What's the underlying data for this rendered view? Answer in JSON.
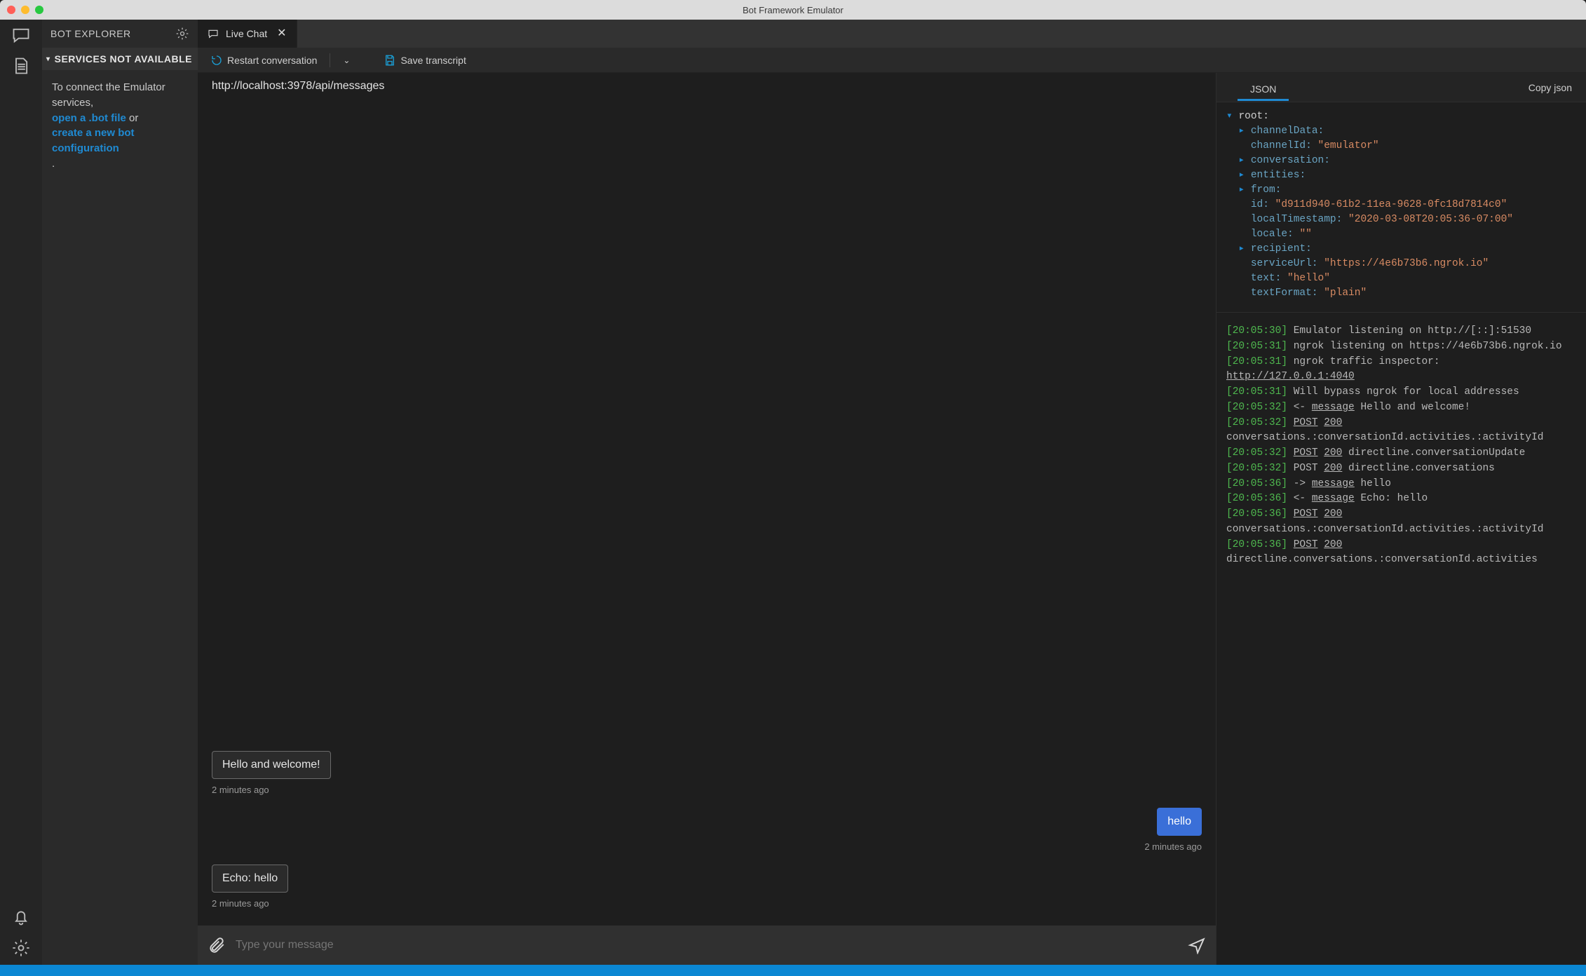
{
  "window": {
    "title": "Bot Framework Emulator"
  },
  "explorer": {
    "title": "BOT EXPLORER",
    "section": "SERVICES NOT AVAILABLE",
    "intro": "To connect the Emulator services,",
    "link_open": "open a .bot file",
    "or": " or ",
    "link_create": "create a new bot configuration",
    "period": "."
  },
  "tab": {
    "label": "Live Chat"
  },
  "toolbar": {
    "restart": "Restart conversation",
    "save": "Save transcript"
  },
  "endpoint": "http://localhost:3978/api/messages",
  "chat": {
    "messages": [
      {
        "from": "bot",
        "text": "Hello and welcome!",
        "ts": "2 minutes ago"
      },
      {
        "from": "me",
        "text": "hello",
        "ts": "2 minutes ago"
      },
      {
        "from": "bot",
        "text": "Echo: hello",
        "ts": "2 minutes ago"
      }
    ],
    "placeholder": "Type your message"
  },
  "inspector": {
    "tab": "JSON",
    "copy": "Copy json"
  },
  "json": {
    "root": "root:",
    "channelData": "channelData:",
    "channelId_k": "channelId:",
    "channelId_v": "\"emulator\"",
    "conversation": "conversation:",
    "entities": "entities:",
    "from": "from:",
    "id_k": "id:",
    "id_v": "\"d911d940-61b2-11ea-9628-0fc18d7814c0\"",
    "localTimestamp_k": "localTimestamp:",
    "localTimestamp_v": "\"2020-03-08T20:05:36-07:00\"",
    "locale_k": "locale:",
    "locale_v": "\"\"",
    "recipient": "recipient:",
    "serviceUrl_k": "serviceUrl:",
    "serviceUrl_v": "\"https://4e6b73b6.ngrok.io\"",
    "text_k": "text:",
    "text_v": "\"hello\"",
    "textFormat_k": "textFormat:",
    "textFormat_v": "\"plain\""
  },
  "log": {
    "l1_ts": "[20:05:30]",
    "l1": " Emulator listening on http://[::]:51530",
    "l2_ts": "[20:05:31]",
    "l2": " ngrok listening on https://4e6b73b6.ngrok.io",
    "l3_ts": "[20:05:31]",
    "l3a": " ngrok traffic inspector: ",
    "l3b": "http://127.0.0.1:4040",
    "l4_ts": "[20:05:31]",
    "l4": " Will bypass ngrok for local addresses",
    "l5_ts": "[20:05:32]",
    "l5a": " <- ",
    "l5b": "message",
    "l5c": " Hello and welcome!",
    "l6_ts": "[20:05:32]",
    "l6a": " ",
    "l6b": "POST",
    "l6c": " ",
    "l6d": "200",
    "l6e": " conversations.:conversationId.activities.:activityId",
    "l7_ts": "[20:05:32]",
    "l7a": " ",
    "l7b": "POST",
    "l7c": " ",
    "l7d": "200",
    "l7e": " directline.conversationUpdate",
    "l8_ts": "[20:05:32]",
    "l8a": " POST ",
    "l8b": "200",
    "l8c": " directline.conversations",
    "l9_ts": "[20:05:36]",
    "l9a": " -> ",
    "l9b": "message",
    "l9c": " hello",
    "l10_ts": "[20:05:36]",
    "l10a": " <- ",
    "l10b": "message",
    "l10c": " Echo: hello",
    "l11_ts": "[20:05:36]",
    "l11a": " ",
    "l11b": "POST",
    "l11c": " ",
    "l11d": "200",
    "l11e": " conversations.:conversationId.activities.:activityId",
    "l12_ts": "[20:05:36]",
    "l12a": " ",
    "l12b": "POST",
    "l12c": " ",
    "l12d": "200",
    "l12e": " directline.conversations.:conversationId.activities"
  }
}
